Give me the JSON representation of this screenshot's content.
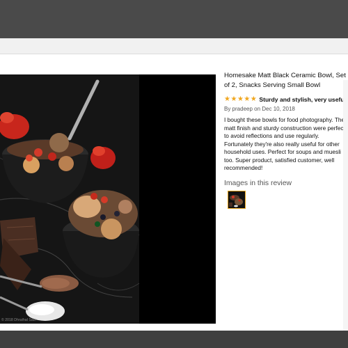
{
  "photo": {
    "credit": "© 2018 Dhruthal Sabi"
  },
  "product": {
    "title": "Homesake Matt Black Ceramic Bowl, Set of 2, Snacks Serving Small Bowl"
  },
  "review": {
    "rating": 5,
    "max_rating": 5,
    "title": "Sturdy and stylish, very useful",
    "byline": "By pradeep on Dec 10, 2018",
    "body": "I bought these bowls for food photography. The matt finish and sturdy construction were perfect to avoid reflections and use regularly. Fortunately they're also really useful for other household uses. Perfect for soups and muesli too. Super product, satisfied customer, well recommended!"
  },
  "images_section": {
    "heading": "Images in this review",
    "thumbnail_count": 1
  },
  "colors": {
    "star": "#f0a61d",
    "thumb_border": "#e8a41a",
    "overlay": "#3f3f3f"
  }
}
